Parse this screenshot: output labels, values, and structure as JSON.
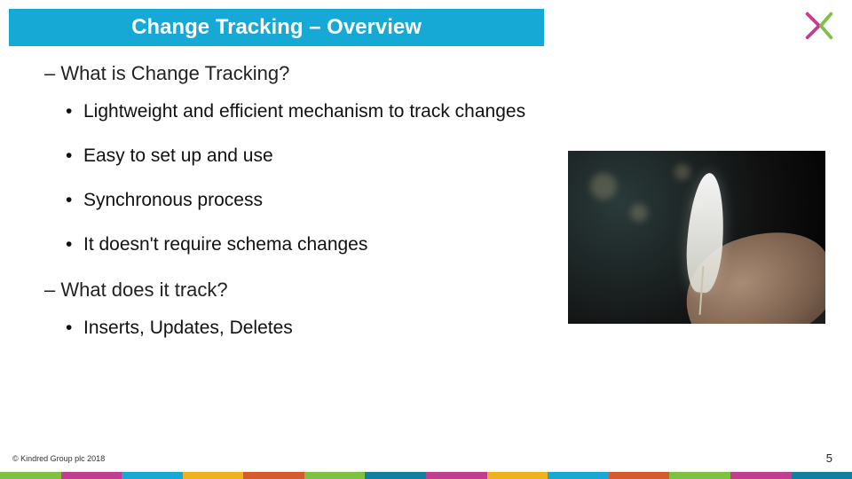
{
  "title": "Change Tracking – Overview",
  "sections": [
    {
      "heading": "– What is Change Tracking?",
      "bullets": [
        "Lightweight and efficient mechanism to track changes",
        "Easy to set up and use",
        "Synchronous process",
        "It doesn't require schema changes"
      ]
    },
    {
      "heading": "– What does it track?",
      "bullets": [
        "Inserts, Updates, Deletes"
      ]
    }
  ],
  "footer": {
    "copyright": "© Kindred Group plc 2018",
    "page": "5"
  },
  "brand": {
    "logo_name": "kindred-logo",
    "strip_colors": [
      "#7fc241",
      "#c43c8f",
      "#17a9d6",
      "#efb21a",
      "#d85a2b",
      "#7fc241",
      "#117f9e",
      "#c43c8f",
      "#efb21a",
      "#17a9d6",
      "#d85a2b",
      "#7fc241",
      "#c43c8f",
      "#117f9e"
    ]
  },
  "image": {
    "alt": "hand holding a white feather at night with bokeh lights"
  }
}
